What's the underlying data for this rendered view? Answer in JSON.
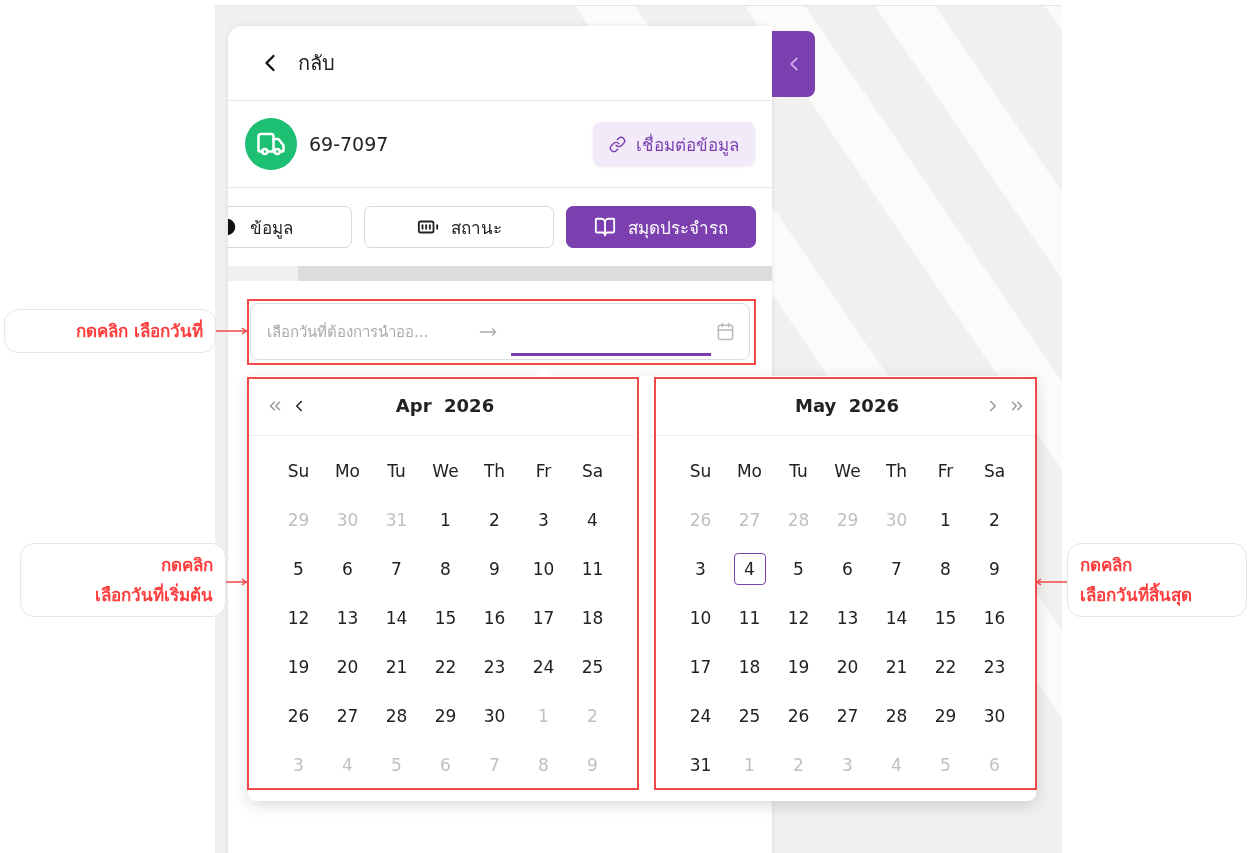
{
  "header": {
    "back_label": "กลับ"
  },
  "vehicle": {
    "plate": "69-7097",
    "link_button": "เชื่อมต่อข้อมูล"
  },
  "tabs": [
    {
      "label": "ข้อมูล",
      "selected": false,
      "kind": "info"
    },
    {
      "label": "สถานะ",
      "selected": false,
      "kind": "battery"
    },
    {
      "label": "สมุดประจำรถ",
      "selected": true,
      "kind": "book"
    }
  ],
  "date_range": {
    "placeholder": "เลือกวันที่ต้องการนำออ...",
    "end_active": true
  },
  "calendars": [
    {
      "month": "Apr",
      "year": "2026",
      "kind": "prev",
      "weekdays": [
        "Su",
        "Mo",
        "Tu",
        "We",
        "Th",
        "Fr",
        "Sa"
      ],
      "weeks": [
        [
          {
            "d": "29",
            "muted": true,
            "today": false
          },
          {
            "d": "30",
            "muted": true,
            "today": false
          },
          {
            "d": "31",
            "muted": true,
            "today": false
          },
          {
            "d": "1",
            "muted": false,
            "today": false
          },
          {
            "d": "2",
            "muted": false,
            "today": false
          },
          {
            "d": "3",
            "muted": false,
            "today": false
          },
          {
            "d": "4",
            "muted": false,
            "today": false
          }
        ],
        [
          {
            "d": "5",
            "muted": false,
            "today": false
          },
          {
            "d": "6",
            "muted": false,
            "today": false
          },
          {
            "d": "7",
            "muted": false,
            "today": false
          },
          {
            "d": "8",
            "muted": false,
            "today": false
          },
          {
            "d": "9",
            "muted": false,
            "today": false
          },
          {
            "d": "10",
            "muted": false,
            "today": false
          },
          {
            "d": "11",
            "muted": false,
            "today": false
          }
        ],
        [
          {
            "d": "12",
            "muted": false,
            "today": false
          },
          {
            "d": "13",
            "muted": false,
            "today": false
          },
          {
            "d": "14",
            "muted": false,
            "today": false
          },
          {
            "d": "15",
            "muted": false,
            "today": false
          },
          {
            "d": "16",
            "muted": false,
            "today": false
          },
          {
            "d": "17",
            "muted": false,
            "today": false
          },
          {
            "d": "18",
            "muted": false,
            "today": false
          }
        ],
        [
          {
            "d": "19",
            "muted": false,
            "today": false
          },
          {
            "d": "20",
            "muted": false,
            "today": false
          },
          {
            "d": "21",
            "muted": false,
            "today": false
          },
          {
            "d": "22",
            "muted": false,
            "today": false
          },
          {
            "d": "23",
            "muted": false,
            "today": false
          },
          {
            "d": "24",
            "muted": false,
            "today": false
          },
          {
            "d": "25",
            "muted": false,
            "today": false
          }
        ],
        [
          {
            "d": "26",
            "muted": false,
            "today": false
          },
          {
            "d": "27",
            "muted": false,
            "today": false
          },
          {
            "d": "28",
            "muted": false,
            "today": false
          },
          {
            "d": "29",
            "muted": false,
            "today": false
          },
          {
            "d": "30",
            "muted": false,
            "today": false
          },
          {
            "d": "1",
            "muted": true,
            "today": false
          },
          {
            "d": "2",
            "muted": true,
            "today": false
          }
        ],
        [
          {
            "d": "3",
            "muted": true,
            "today": false
          },
          {
            "d": "4",
            "muted": true,
            "today": false
          },
          {
            "d": "5",
            "muted": true,
            "today": false
          },
          {
            "d": "6",
            "muted": true,
            "today": false
          },
          {
            "d": "7",
            "muted": true,
            "today": false
          },
          {
            "d": "8",
            "muted": true,
            "today": false
          },
          {
            "d": "9",
            "muted": true,
            "today": false
          }
        ]
      ]
    },
    {
      "month": "May",
      "year": "2026",
      "kind": "next",
      "weekdays": [
        "Su",
        "Mo",
        "Tu",
        "We",
        "Th",
        "Fr",
        "Sa"
      ],
      "weeks": [
        [
          {
            "d": "26",
            "muted": true,
            "today": false
          },
          {
            "d": "27",
            "muted": true,
            "today": false
          },
          {
            "d": "28",
            "muted": true,
            "today": false
          },
          {
            "d": "29",
            "muted": true,
            "today": false
          },
          {
            "d": "30",
            "muted": true,
            "today": false
          },
          {
            "d": "1",
            "muted": false,
            "today": false
          },
          {
            "d": "2",
            "muted": false,
            "today": false
          }
        ],
        [
          {
            "d": "3",
            "muted": false,
            "today": false
          },
          {
            "d": "4",
            "muted": false,
            "today": true
          },
          {
            "d": "5",
            "muted": false,
            "today": false
          },
          {
            "d": "6",
            "muted": false,
            "today": false
          },
          {
            "d": "7",
            "muted": false,
            "today": false
          },
          {
            "d": "8",
            "muted": false,
            "today": false
          },
          {
            "d": "9",
            "muted": false,
            "today": false
          }
        ],
        [
          {
            "d": "10",
            "muted": false,
            "today": false
          },
          {
            "d": "11",
            "muted": false,
            "today": false
          },
          {
            "d": "12",
            "muted": false,
            "today": false
          },
          {
            "d": "13",
            "muted": false,
            "today": false
          },
          {
            "d": "14",
            "muted": false,
            "today": false
          },
          {
            "d": "15",
            "muted": false,
            "today": false
          },
          {
            "d": "16",
            "muted": false,
            "today": false
          }
        ],
        [
          {
            "d": "17",
            "muted": false,
            "today": false
          },
          {
            "d": "18",
            "muted": false,
            "today": false
          },
          {
            "d": "19",
            "muted": false,
            "today": false
          },
          {
            "d": "20",
            "muted": false,
            "today": false
          },
          {
            "d": "21",
            "muted": false,
            "today": false
          },
          {
            "d": "22",
            "muted": false,
            "today": false
          },
          {
            "d": "23",
            "muted": false,
            "today": false
          }
        ],
        [
          {
            "d": "24",
            "muted": false,
            "today": false
          },
          {
            "d": "25",
            "muted": false,
            "today": false
          },
          {
            "d": "26",
            "muted": false,
            "today": false
          },
          {
            "d": "27",
            "muted": false,
            "today": false
          },
          {
            "d": "28",
            "muted": false,
            "today": false
          },
          {
            "d": "29",
            "muted": false,
            "today": false
          },
          {
            "d": "30",
            "muted": false,
            "today": false
          }
        ],
        [
          {
            "d": "31",
            "muted": false,
            "today": false
          },
          {
            "d": "1",
            "muted": true,
            "today": false
          },
          {
            "d": "2",
            "muted": true,
            "today": false
          },
          {
            "d": "3",
            "muted": true,
            "today": false
          },
          {
            "d": "4",
            "muted": true,
            "today": false
          },
          {
            "d": "5",
            "muted": true,
            "today": false
          },
          {
            "d": "6",
            "muted": true,
            "today": false
          }
        ]
      ]
    }
  ],
  "annotations": [
    {
      "text": "กดคลิก เลือกวันที่",
      "kind": "left"
    },
    {
      "text": "กดคลิก\nเลือกวันที่เริ่มต้น",
      "kind": "left"
    },
    {
      "text": "กดคลิก\nเลือกวันที่สิ้นสุด",
      "kind": "right"
    }
  ]
}
